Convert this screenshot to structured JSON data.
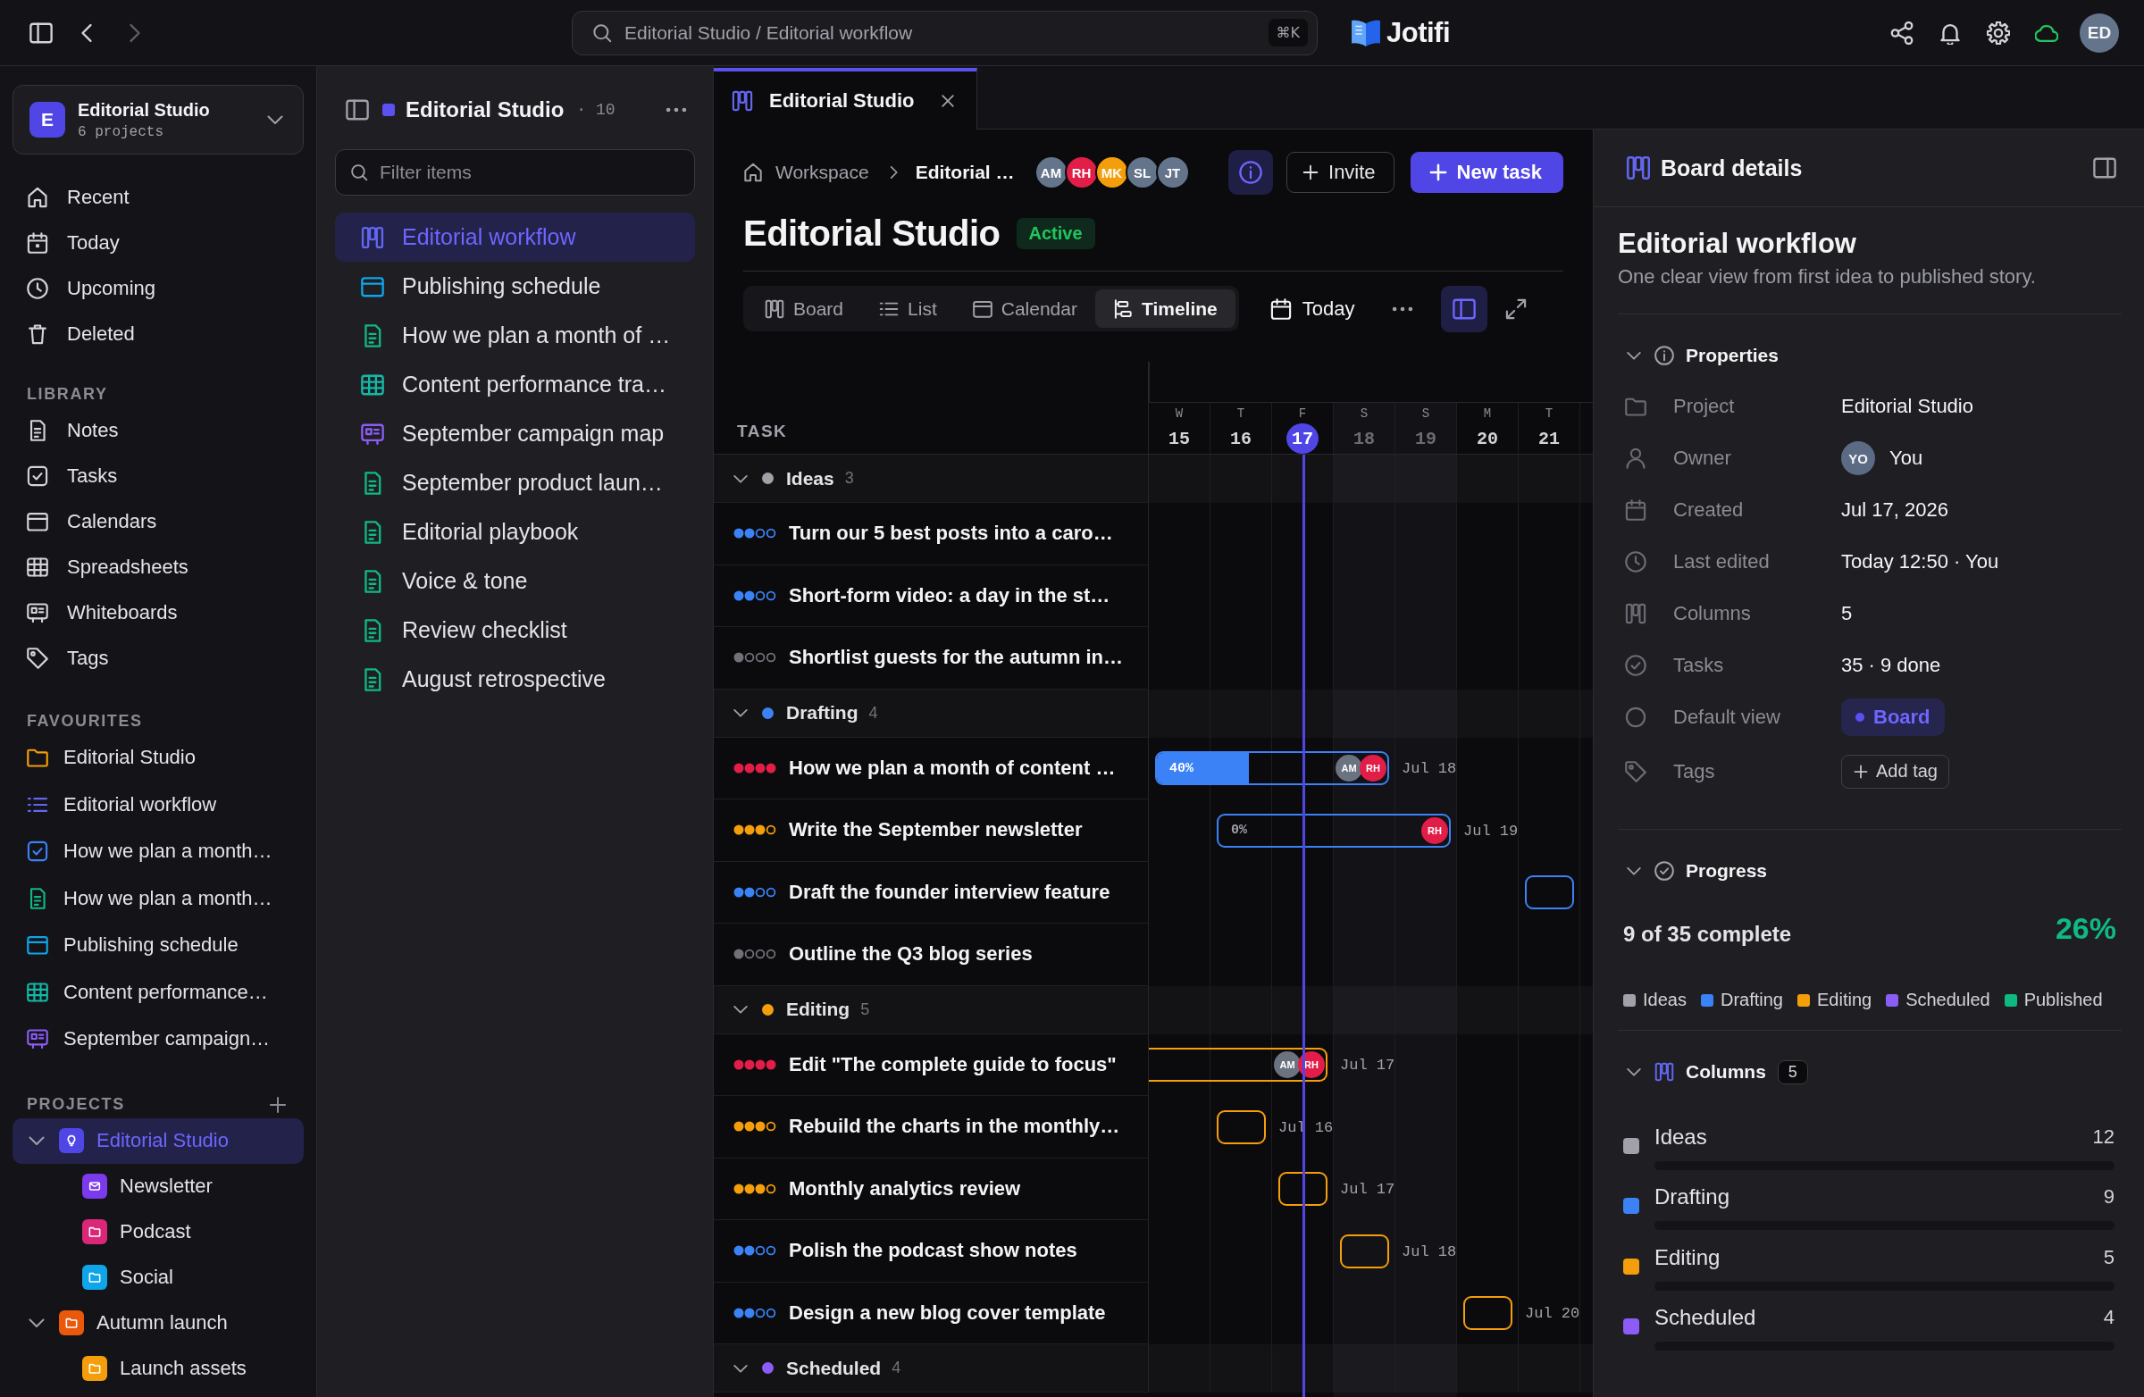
{
  "topbar": {
    "back": {
      "disabled": false
    },
    "forward": {
      "disabled": true
    },
    "search": "Editorial Studio / Editorial workflow",
    "shortcut": "⌘K",
    "logo": "Jotifi",
    "user": "ED"
  },
  "sidebar": {
    "workspace": {
      "badge": "E",
      "name": "Editorial Studio",
      "meta": "6 projects"
    },
    "nav": [
      {
        "label": "Recent",
        "kind": "recent",
        "selected": false
      },
      {
        "label": "Today",
        "kind": "today",
        "selected": false
      },
      {
        "label": "Upcoming",
        "kind": "upcoming",
        "selected": false
      },
      {
        "label": "Deleted",
        "kind": "deleted",
        "selected": false
      }
    ],
    "library": {
      "heading": "LIBRARY",
      "items": [
        {
          "label": "Notes",
          "kind": "notes",
          "selected": false
        },
        {
          "label": "Tasks",
          "kind": "tasks",
          "selected": false
        },
        {
          "label": "Calendars",
          "kind": "calendars",
          "selected": false
        },
        {
          "label": "Spreadsheets",
          "kind": "spreadsheets",
          "selected": false
        },
        {
          "label": "Whiteboards",
          "kind": "whiteboards",
          "selected": false
        },
        {
          "label": "Tags",
          "kind": "tags",
          "selected": false
        }
      ]
    },
    "favourites": {
      "heading": "FAVOURITES",
      "items": [
        {
          "label": "Editorial Studio",
          "kind": "folder",
          "selected": false
        },
        {
          "label": "Editorial workflow",
          "kind": "list",
          "selected": false
        },
        {
          "label": "How we plan a month…",
          "kind": "task",
          "selected": false
        },
        {
          "label": "How we plan a month…",
          "kind": "note",
          "selected": false
        },
        {
          "label": "Publishing schedule",
          "kind": "calendar",
          "selected": false
        },
        {
          "label": "Content performance…",
          "kind": "spreadsheet",
          "selected": false
        },
        {
          "label": "September campaign…",
          "kind": "whiteboard",
          "selected": false
        }
      ]
    },
    "projects": {
      "heading": "PROJECTS",
      "items": [
        {
          "label": "Editorial Studio",
          "kind": "idea",
          "color": "#4f46e5",
          "selected": true,
          "expanded": true,
          "children": [
            {
              "label": "Newsletter",
              "kind": "mail",
              "color": "#7c3aed",
              "selected": false
            },
            {
              "label": "Podcast",
              "kind": "folder",
              "color": "#db2777",
              "selected": false
            },
            {
              "label": "Social",
              "kind": "folder",
              "color": "#0ea5e9",
              "selected": false
            }
          ]
        },
        {
          "label": "Autumn launch",
          "kind": "folder",
          "color": "#ea580c",
          "selected": false,
          "expanded": true,
          "children": [
            {
              "label": "Launch assets",
              "kind": "folder",
              "color": "#f59e0b",
              "selected": false
            }
          ]
        }
      ]
    }
  },
  "library_panel": {
    "title": "Editorial Studio",
    "count": "· 10",
    "filter_placeholder": "Filter items",
    "items": [
      {
        "label": "Editorial workflow",
        "kind": "board",
        "selected": true
      },
      {
        "label": "Publishing schedule",
        "kind": "calendar",
        "selected": false
      },
      {
        "label": "How we plan a month of …",
        "kind": "note",
        "selected": false
      },
      {
        "label": "Content performance tra…",
        "kind": "spreadsheet",
        "selected": false
      },
      {
        "label": "September campaign map",
        "kind": "whiteboard",
        "selected": false
      },
      {
        "label": "September product laun…",
        "kind": "note",
        "selected": false
      },
      {
        "label": "Editorial playbook",
        "kind": "note",
        "selected": false
      },
      {
        "label": "Voice & tone",
        "kind": "note",
        "selected": false
      },
      {
        "label": "Review checklist",
        "kind": "note",
        "selected": false
      },
      {
        "label": "August retrospective",
        "kind": "note",
        "selected": false
      }
    ]
  },
  "tabs": [
    {
      "title": "Editorial Studio",
      "selected": true
    }
  ],
  "board": {
    "breadcrumb": [
      {
        "label": "Workspace",
        "kind": "root"
      },
      {
        "label": "Editorial …",
        "kind": "current"
      }
    ],
    "members": [
      {
        "initials": "AM",
        "color": "#64748b"
      },
      {
        "initials": "RH",
        "color": "#e11d48"
      },
      {
        "initials": "MK",
        "color": "#f59e0b"
      },
      {
        "initials": "SL",
        "color": "#64748b"
      },
      {
        "initials": "JT",
        "color": "#64748b"
      }
    ],
    "invite": "Invite",
    "new_task": "New task",
    "title": "Editorial Studio",
    "status": "Active",
    "views": [
      {
        "label": "Board",
        "kind": "board",
        "selected": false
      },
      {
        "label": "List",
        "kind": "list",
        "selected": false
      },
      {
        "label": "Calendar",
        "kind": "calendar",
        "selected": false
      },
      {
        "label": "Timeline",
        "kind": "timeline",
        "selected": true
      }
    ],
    "today": "Today",
    "details_open": true,
    "timeline": {
      "task_header": "TASK",
      "days": [
        {
          "weekday": "W",
          "day": "15",
          "weekend": false,
          "today": false
        },
        {
          "weekday": "T",
          "day": "16",
          "weekend": false,
          "today": false
        },
        {
          "weekday": "F",
          "day": "17",
          "weekend": false,
          "today": true
        },
        {
          "weekday": "S",
          "day": "18",
          "weekend": true,
          "today": false
        },
        {
          "weekday": "S",
          "day": "19",
          "weekend": true,
          "today": false
        },
        {
          "weekday": "M",
          "day": "20",
          "weekend": false,
          "today": false
        },
        {
          "weekday": "T",
          "day": "21",
          "weekend": false,
          "today": false
        }
      ],
      "groups": [
        {
          "name": "Ideas",
          "count": "3",
          "color": "#a1a1aa",
          "expanded": true,
          "tasks": [
            {
              "title": "Turn our 5 best posts into a caro…",
              "stars": 2
            },
            {
              "title": "Short-form video: a day in the st…",
              "stars": 2
            },
            {
              "title": "Shortlist guests for the autumn in…",
              "stars": 1
            }
          ]
        },
        {
          "name": "Drafting",
          "count": "4",
          "color": "#3b82f6",
          "expanded": true,
          "tasks": [
            {
              "title": "How we plan a month of content …",
              "stars": 4,
              "bar": {
                "open_start": false,
                "span": [
                  true,
                  true,
                  true,
                  true,
                  false,
                  false,
                  false
                ],
                "due": "Jul 18",
                "progress": "40%",
                "level": 0.4,
                "assignees": [
                  {
                    "initials": "AM",
                    "color": "#6b7280"
                  },
                  {
                    "initials": "RH",
                    "color": "#e11d48"
                  }
                ]
              }
            },
            {
              "title": "Write the September newsletter",
              "stars": 3,
              "bar": {
                "open_start": false,
                "span": [
                  false,
                  true,
                  true,
                  true,
                  true,
                  false,
                  false
                ],
                "due": "Jul 19",
                "progress": "0%",
                "assignees": [
                  {
                    "initials": "RH",
                    "color": "#e11d48"
                  }
                ]
              }
            },
            {
              "title": "Draft the founder interview feature",
              "stars": 2,
              "bar": {
                "open_start": false,
                "span": [
                  false,
                  false,
                  false,
                  false,
                  false,
                  false,
                  true
                ]
              }
            },
            {
              "title": "Outline the Q3 blog series",
              "stars": 1
            }
          ]
        },
        {
          "name": "Editing",
          "count": "5",
          "color": "#f59e0b",
          "expanded": true,
          "tasks": [
            {
              "title": "Edit \"The complete guide to focus\"",
              "stars": 4,
              "bar": {
                "open_start": true,
                "span": [
                  true,
                  true,
                  true,
                  false,
                  false,
                  false,
                  false
                ],
                "due": "Jul 17",
                "assignees": [
                  {
                    "initials": "AM",
                    "color": "#6b7280"
                  },
                  {
                    "initials": "RH",
                    "color": "#e11d48"
                  }
                ]
              }
            },
            {
              "title": "Rebuild the charts in the monthly…",
              "stars": 3,
              "bar": {
                "open_start": false,
                "span": [
                  false,
                  true,
                  false,
                  false,
                  false,
                  false,
                  false
                ],
                "due": "Jul 16"
              }
            },
            {
              "title": "Monthly analytics review",
              "stars": 3,
              "bar": {
                "open_start": false,
                "span": [
                  false,
                  false,
                  true,
                  false,
                  false,
                  false,
                  false
                ],
                "due": "Jul 17"
              }
            },
            {
              "title": "Polish the podcast show notes",
              "stars": 2,
              "bar": {
                "open_start": false,
                "span": [
                  false,
                  false,
                  false,
                  true,
                  false,
                  false,
                  false
                ],
                "due": "Jul 18"
              }
            },
            {
              "title": "Design a new blog cover template",
              "stars": 2,
              "bar": {
                "open_start": false,
                "span": [
                  false,
                  false,
                  false,
                  false,
                  false,
                  true,
                  false
                ],
                "due": "Jul 20"
              }
            }
          ]
        },
        {
          "name": "Scheduled",
          "count": "4",
          "color": "#8b5cf6",
          "expanded": true
        }
      ]
    }
  },
  "details": {
    "header": "Board details",
    "title": "Editorial workflow",
    "description": "One clear view from first idea to published story.",
    "properties": {
      "heading": "Properties",
      "expanded": true,
      "rows": [
        {
          "kind": "project",
          "label": "Project",
          "value": "Editorial Studio"
        },
        {
          "kind": "owner",
          "label": "Owner",
          "avatar": "YO",
          "value": "You"
        },
        {
          "kind": "created",
          "label": "Created",
          "value": "Jul 17, 2026"
        },
        {
          "kind": "edited",
          "label": "Last edited",
          "value": "Today 12:50 · You"
        },
        {
          "kind": "columns",
          "label": "Columns",
          "value": "5"
        },
        {
          "kind": "tasks",
          "label": "Tasks",
          "value": "35 · 9 done"
        },
        {
          "kind": "view",
          "label": "Default view",
          "option": "Board"
        },
        {
          "kind": "tags",
          "label": "Tags",
          "button": "Add tag"
        }
      ]
    },
    "progress": {
      "heading": "Progress",
      "expanded": true,
      "summary": "9 of 35 complete",
      "percent": "26%",
      "legend": [
        {
          "label": "Ideas",
          "color": "#a1a1aa"
        },
        {
          "label": "Drafting",
          "color": "#3b82f6"
        },
        {
          "label": "Editing",
          "color": "#f59e0b"
        },
        {
          "label": "Scheduled",
          "color": "#8b5cf6"
        },
        {
          "label": "Published",
          "color": "#10b981"
        }
      ]
    },
    "columns": {
      "heading": "Columns",
      "count": "5",
      "expanded": true,
      "items": [
        {
          "name": "Ideas",
          "count": "12",
          "color": "#a1a1aa"
        },
        {
          "name": "Drafting",
          "count": "9",
          "color": "#3b82f6"
        },
        {
          "name": "Editing",
          "count": "5",
          "color": "#f59e0b"
        },
        {
          "name": "Scheduled",
          "count": "4",
          "color": "#8b5cf6"
        }
      ]
    }
  }
}
